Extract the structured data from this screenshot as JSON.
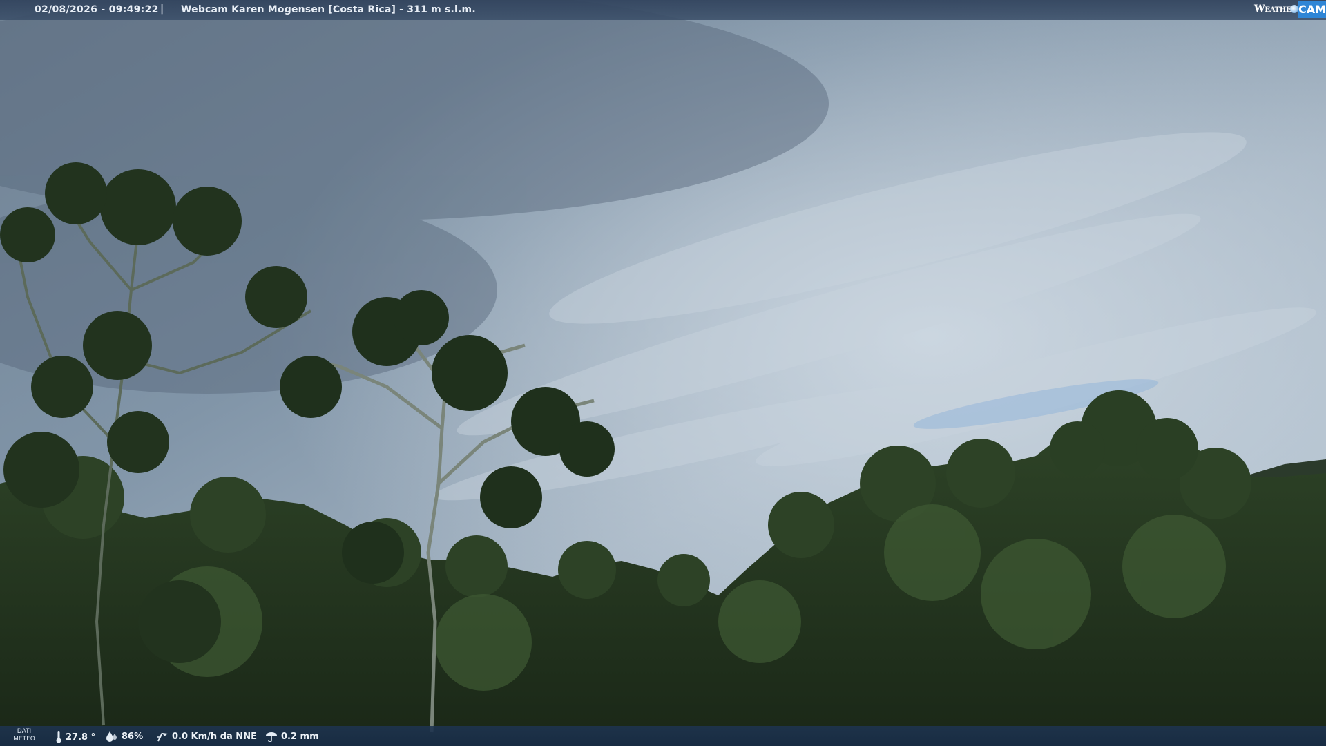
{
  "overlay": {
    "datetime": "02/08/2026 - 09:49:22",
    "separator": "|",
    "title": "Webcam Karen Mogensen [Costa Rica]  - 311 m s.l.m.",
    "brand_weather": "Weather",
    "brand_cam": "CAM"
  },
  "weather": {
    "panel_label_line1": "DATI",
    "panel_label_line2": "METEO",
    "temperature": "27.8 °",
    "humidity": "86%",
    "wind": "0.0 Km/h da NNE",
    "rain": "0.2 mm"
  },
  "icons": [
    "thermometer-icon",
    "humidity-icon",
    "wind-icon",
    "rain-gauge-icon"
  ],
  "colors": {
    "sky": "#8fa2b4",
    "foliage": "#25361f",
    "bar": "#2b4a70",
    "brand_accent": "#2f86d6"
  }
}
